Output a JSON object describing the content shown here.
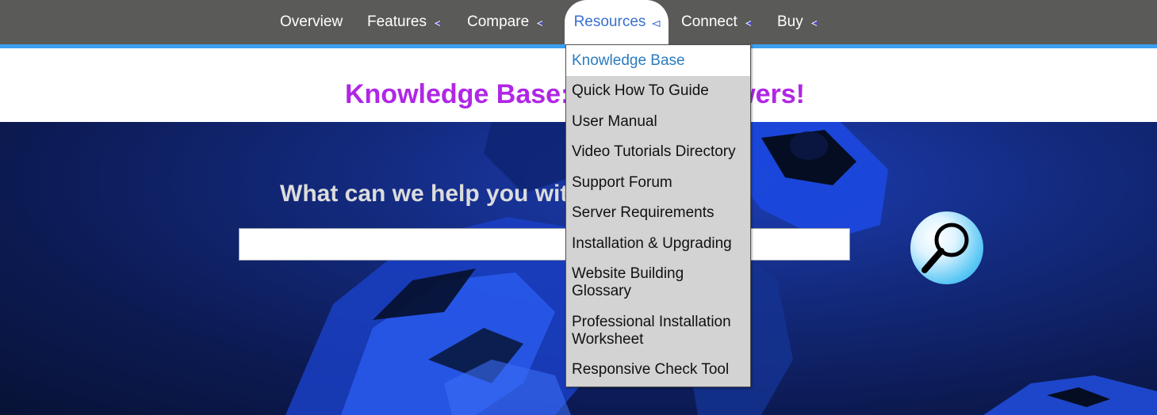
{
  "nav": {
    "items": [
      {
        "label": "Overview",
        "has_caret": false
      },
      {
        "label": "Features",
        "has_caret": true
      },
      {
        "label": "Compare",
        "has_caret": true
      },
      {
        "label": "Resources",
        "has_caret": true,
        "active": true
      },
      {
        "label": "Connect",
        "has_caret": true
      },
      {
        "label": "Buy",
        "has_caret": true
      }
    ]
  },
  "page": {
    "title": "Knowledge Base: All Your Answers!"
  },
  "hero": {
    "heading": "What can we help you with?",
    "search_value": "",
    "search_icon": "magnifier-icon"
  },
  "dropdown": {
    "items": [
      {
        "label": "Knowledge Base"
      },
      {
        "label": "Quick How To Guide"
      },
      {
        "label": "User Manual"
      },
      {
        "label": "Video Tutorials Directory"
      },
      {
        "label": "Support Forum"
      },
      {
        "label": "Server Requirements"
      },
      {
        "label": "Installation & Upgrading"
      },
      {
        "label": "Website Building Glossary"
      },
      {
        "label": "Professional Installation Worksheet"
      },
      {
        "label": "Responsive Check Tool"
      }
    ]
  },
  "colors": {
    "nav_bg": "#5a5a58",
    "nav_accent": "#3aa0f0",
    "title": "#b026e6",
    "active_nav_text": "#3a6fd0",
    "dropdown_bg": "#d3d3d3",
    "dropdown_first_text": "#2b7bbf"
  }
}
